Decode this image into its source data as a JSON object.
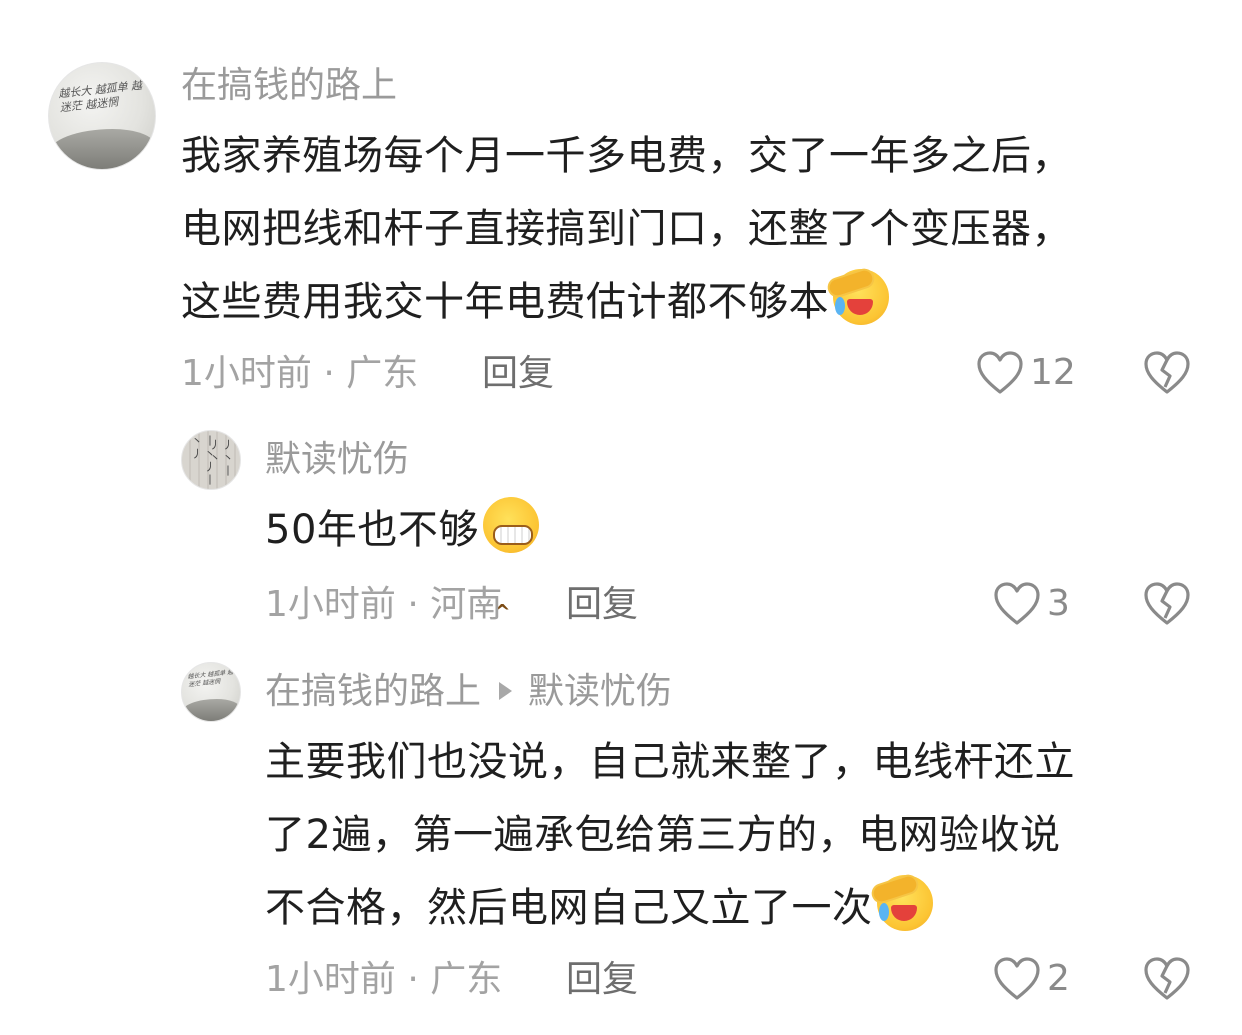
{
  "comments": [
    {
      "username": "在搞钱的路上",
      "avatar_text": "越长大 越孤单 越迷茫 越迷惘",
      "lines": [
        "我家养殖场每个月一千多电费，交了一年多之后，",
        "电网把线和杆子直接搞到门口，还整了个变压器，",
        "这些费用我交十年电费估计都不够本"
      ],
      "emoji": "facepalm-laugh-cry-emoji",
      "time": "1小时前",
      "location": "广东",
      "reply_label": "回复",
      "likes": "12"
    },
    {
      "username": "默读忧伤",
      "lines": [
        "50年也不够"
      ],
      "emoji": "grin-emoji",
      "time": "1小时前",
      "location": "河南",
      "reply_label": "回复",
      "likes": "3"
    },
    {
      "username": "在搞钱的路上",
      "reply_to": "默读忧伤",
      "avatar_text": "越长大 越孤单 越迷茫 越迷惘",
      "lines": [
        "主要我们也没说，自己就来整了，电线杆还立",
        "了2遍，第一遍承包给第三方的，电网验收说",
        "不合格，然后电网自己又立了一次"
      ],
      "emoji": "facepalm-laugh-cry-emoji",
      "time": "1小时前",
      "location": "广东",
      "reply_label": "回复",
      "likes": "2"
    }
  ],
  "meta_separator": " · ",
  "colors": {
    "text": "#1f1f1f",
    "muted": "#a3a3a3",
    "reply": "#6e6e6e",
    "icon": "#8a8a8a"
  }
}
